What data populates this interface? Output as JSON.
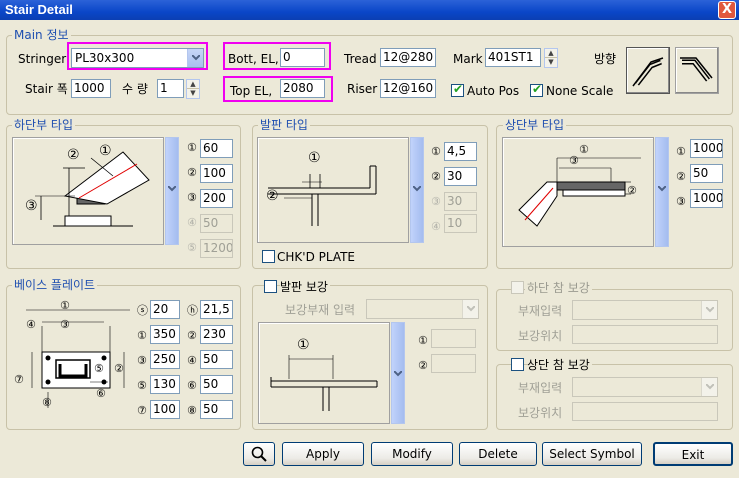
{
  "window": {
    "title": "Stair Detail",
    "close": "X"
  },
  "main": {
    "title": "Main 정보",
    "stringer_label": "Stringer",
    "stringer_value": "PL30x300",
    "bott_el_label": "Bott, EL,",
    "bott_el_value": "0",
    "tread_label": "Tread",
    "tread_value": "12@280",
    "mark_label": "Mark",
    "mark_value": "401ST1",
    "direction_label": "방향",
    "stair_width_label": "Stair 폭",
    "stair_width_value": "1000",
    "qty_label": "수 량",
    "qty_value": "1",
    "top_el_label": "Top EL,",
    "top_el_value": "2080",
    "riser_label": "Riser",
    "riser_value": "12@160",
    "auto_pos_label": "Auto Pos",
    "none_scale_label": "None Scale",
    "auto_pos_checked": true,
    "none_scale_checked": true
  },
  "lower_type": {
    "title": "하단부 타입",
    "markers": [
      "①",
      "②",
      "③",
      "④",
      "⑤"
    ],
    "values": [
      "60",
      "100",
      "200",
      "50",
      "1200"
    ],
    "diagram_labels": [
      "②",
      "①",
      "③"
    ]
  },
  "footplate_type": {
    "title": "발판 타입",
    "markers": [
      "①",
      "②",
      "③",
      "④"
    ],
    "values": [
      "4,5",
      "30",
      "30",
      "10"
    ],
    "diagram_labels": [
      "①",
      "②"
    ],
    "checked_plate_label": "CHK'D PLATE"
  },
  "upper_type": {
    "title": "상단부 타입",
    "markers": [
      "①",
      "②",
      "③"
    ],
    "values": [
      "1000",
      "50",
      "1000"
    ],
    "diagram_labels": [
      "①",
      "③",
      "②"
    ]
  },
  "base_plate": {
    "title": "베이스 플레이트",
    "rows": [
      {
        "m1": "ⓢ",
        "v1": "20",
        "m2": "ⓗ",
        "v2": "21,5"
      },
      {
        "m1": "①",
        "v1": "350",
        "m2": "②",
        "v2": "230"
      },
      {
        "m1": "③",
        "v1": "250",
        "m2": "④",
        "v2": "50"
      },
      {
        "m1": "⑤",
        "v1": "130",
        "m2": "⑥",
        "v2": "50"
      },
      {
        "m1": "⑦",
        "v1": "100",
        "m2": "⑧",
        "v2": "50"
      }
    ],
    "diagram_labels": [
      "①",
      "④",
      "③",
      "⑤",
      "②",
      "⑦",
      "⑥",
      "⑧"
    ]
  },
  "footplate_reinforce": {
    "title": "발판 보강",
    "member_label": "보강부재 입력",
    "markers": [
      "①",
      "②"
    ],
    "diagram_labels": [
      "①"
    ]
  },
  "lower_landing": {
    "title": "하단 참 보강",
    "member_label": "부재입력",
    "position_label": "보강위치"
  },
  "upper_landing": {
    "title": "상단 참 보강",
    "member_label": "부재입력",
    "position_label": "보강위치"
  },
  "buttons": {
    "apply": "Apply",
    "modify": "Modify",
    "delete": "Delete",
    "select_symbol": "Select Symbol",
    "exit": "Exit"
  },
  "colors": {
    "highlight": "#F000F0",
    "group_title": "#1F4FB0"
  }
}
